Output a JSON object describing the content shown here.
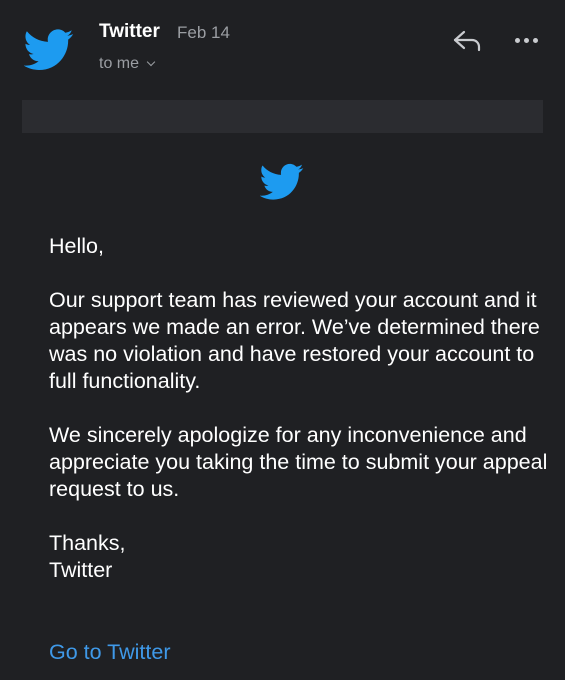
{
  "header": {
    "sender_name": "Twitter",
    "date": "Feb 14",
    "recipients_label": "to me",
    "avatar_icon": "twitter-bird-icon",
    "reply_icon": "reply-arrow-icon",
    "more_icon": "more-horizontal-icon"
  },
  "email": {
    "logo_icon": "twitter-bird-icon",
    "greeting": "Hello,",
    "paragraph_1": "Our support team has reviewed your account and it appears we made an error. We’ve determined there was no violation and have restored your account to full functionality.",
    "paragraph_2": "We sincerely apologize for any inconvenience and appreciate you taking the time to submit your appeal request to us.",
    "signoff": "Thanks,",
    "signature": "Twitter",
    "cta_label": "Go to Twitter"
  },
  "colors": {
    "background": "#1f2023",
    "brand_blue": "#1d9bf0",
    "link_blue": "#3f99e8",
    "muted_text": "#9b9ea3"
  }
}
